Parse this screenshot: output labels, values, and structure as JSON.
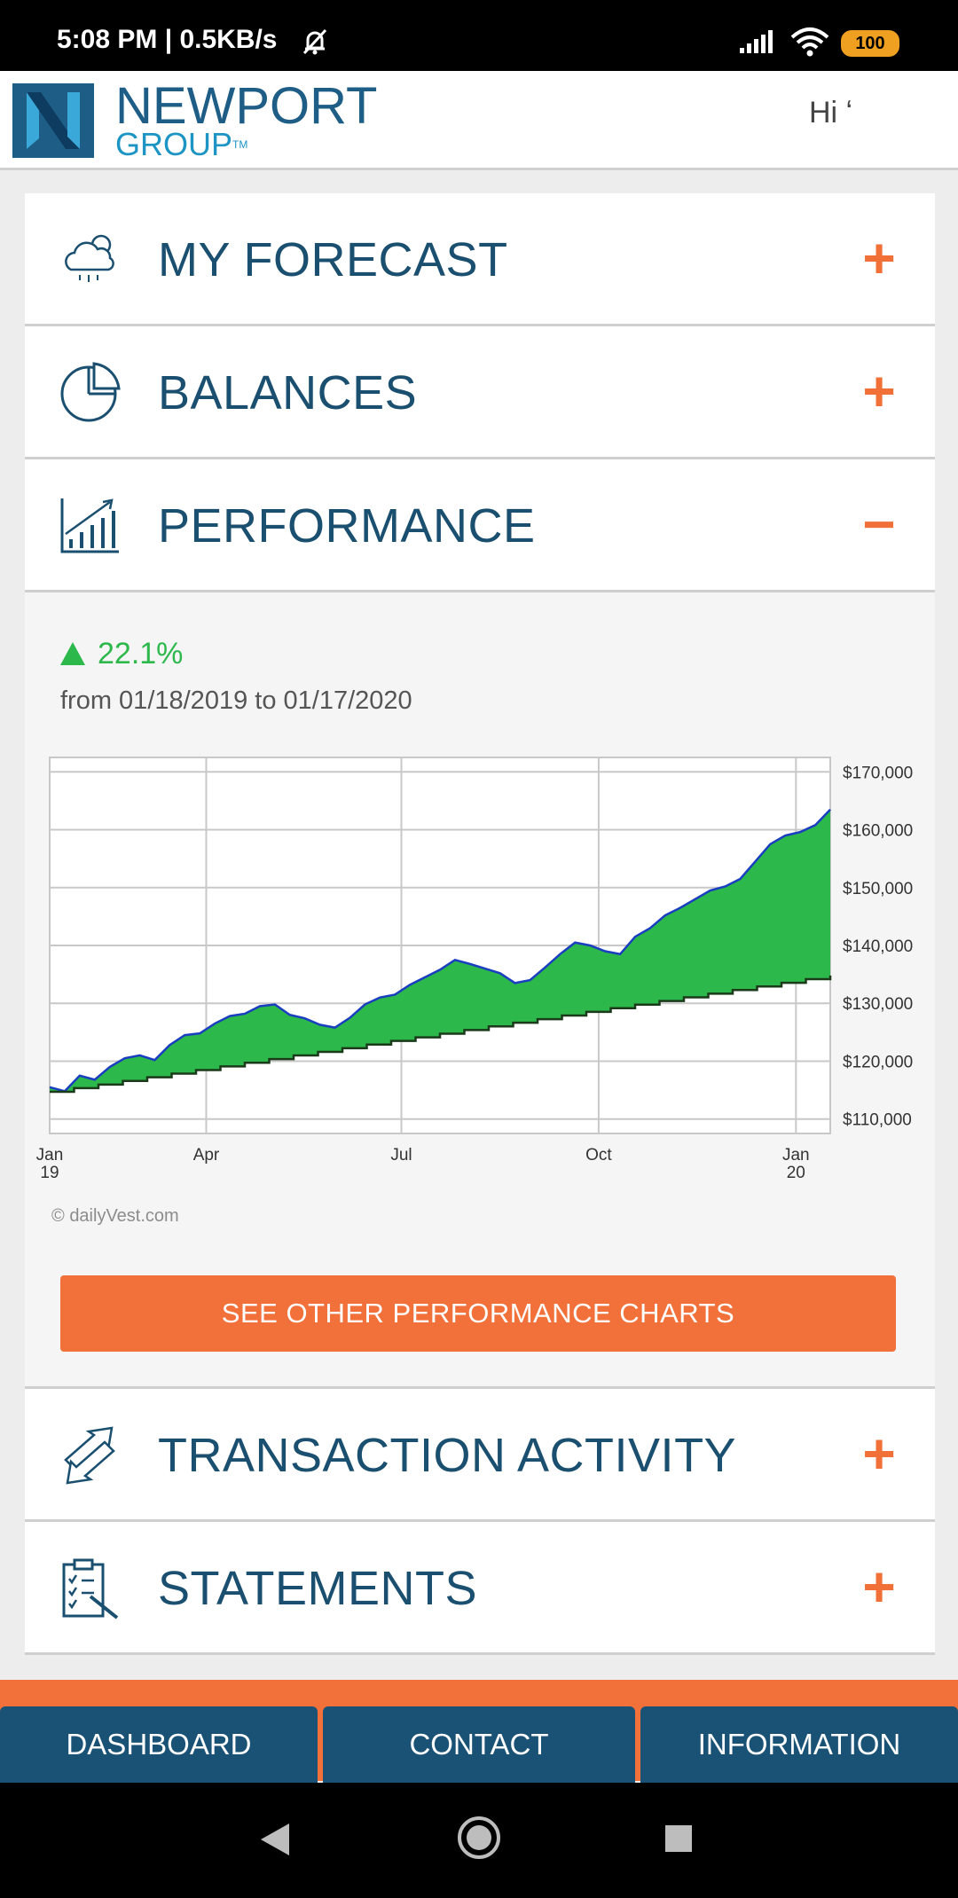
{
  "status_bar": {
    "time": "5:08 PM | 0.5KB/s",
    "battery": "100"
  },
  "header": {
    "logo_line1": "NEWPORT",
    "logo_line2": "GROUP",
    "logo_tm": "TM",
    "greeting": "Hi ʻ"
  },
  "accordion": {
    "forecast_label": "MY FORECAST",
    "balances_label": "BALANCES",
    "performance_label": "PERFORMANCE",
    "transactions_label": "TRANSACTION ACTIVITY",
    "statements_label": "STATEMENTS",
    "expand_symbol": "+",
    "collapse_symbol": "−"
  },
  "performance": {
    "change": "22.1%",
    "range": "from 01/18/2019 to 01/17/2020",
    "button_label": "SEE OTHER PERFORMANCE CHARTS",
    "credit": "dailyVest.com",
    "credit_symbol": "©"
  },
  "chart_data": {
    "type": "area",
    "x_ticks": [
      {
        "label": [
          "Jan",
          "19"
        ],
        "date": "2019-01-18"
      },
      {
        "label": [
          "Apr"
        ],
        "date": "2019-04-01"
      },
      {
        "label": [
          "Jul"
        ],
        "date": "2019-07-01"
      },
      {
        "label": [
          "Oct"
        ],
        "date": "2019-10-01"
      },
      {
        "label": [
          "Jan",
          "20"
        ],
        "date": "2020-01-01"
      }
    ],
    "x_range": [
      "2019-01-18",
      "2020-01-17"
    ],
    "y_ticks": [
      "$170,000",
      "$160,000",
      "$150,000",
      "$140,000",
      "$130,000",
      "$120,000",
      "$110,000"
    ],
    "y_tick_values": [
      170000,
      160000,
      150000,
      140000,
      130000,
      120000,
      110000
    ],
    "ylim": [
      107500,
      172500
    ],
    "grid": true,
    "series": [
      {
        "role": "balance",
        "color": "#2db84b",
        "line_color": "#1a3ec0",
        "points": [
          [
            "2019-01-18",
            115500
          ],
          [
            "2019-01-25",
            114800
          ],
          [
            "2019-02-01",
            117500
          ],
          [
            "2019-02-08",
            116800
          ],
          [
            "2019-02-15",
            119000
          ],
          [
            "2019-02-22",
            120500
          ],
          [
            "2019-03-01",
            121000
          ],
          [
            "2019-03-08",
            120200
          ],
          [
            "2019-03-15",
            122800
          ],
          [
            "2019-03-22",
            124500
          ],
          [
            "2019-03-29",
            124800
          ],
          [
            "2019-04-05",
            126500
          ],
          [
            "2019-04-12",
            127800
          ],
          [
            "2019-04-19",
            128200
          ],
          [
            "2019-04-26",
            129500
          ],
          [
            "2019-05-03",
            129800
          ],
          [
            "2019-05-10",
            128000
          ],
          [
            "2019-05-17",
            127400
          ],
          [
            "2019-05-24",
            126300
          ],
          [
            "2019-05-31",
            125800
          ],
          [
            "2019-06-07",
            127500
          ],
          [
            "2019-06-14",
            129800
          ],
          [
            "2019-06-21",
            131000
          ],
          [
            "2019-06-28",
            131500
          ],
          [
            "2019-07-05",
            133200
          ],
          [
            "2019-07-12",
            134500
          ],
          [
            "2019-07-19",
            135800
          ],
          [
            "2019-07-26",
            137500
          ],
          [
            "2019-08-02",
            136800
          ],
          [
            "2019-08-09",
            136000
          ],
          [
            "2019-08-16",
            135200
          ],
          [
            "2019-08-23",
            133500
          ],
          [
            "2019-08-30",
            134000
          ],
          [
            "2019-09-06",
            136200
          ],
          [
            "2019-09-13",
            138500
          ],
          [
            "2019-09-20",
            140500
          ],
          [
            "2019-09-27",
            140000
          ],
          [
            "2019-10-04",
            139000
          ],
          [
            "2019-10-11",
            138500
          ],
          [
            "2019-10-18",
            141500
          ],
          [
            "2019-10-25",
            143000
          ],
          [
            "2019-11-01",
            145200
          ],
          [
            "2019-11-08",
            146500
          ],
          [
            "2019-11-15",
            148000
          ],
          [
            "2019-11-22",
            149500
          ],
          [
            "2019-11-29",
            150200
          ],
          [
            "2019-12-06",
            151500
          ],
          [
            "2019-12-13",
            154500
          ],
          [
            "2019-12-20",
            157500
          ],
          [
            "2019-12-27",
            159000
          ],
          [
            "2020-01-03",
            159600
          ],
          [
            "2020-01-10",
            160800
          ],
          [
            "2020-01-17",
            163500
          ]
        ]
      },
      {
        "role": "contributions",
        "color": "#1a3a1a",
        "start": [
          "2019-01-18",
          114700
        ],
        "end": [
          "2020-01-17",
          134800
        ]
      }
    ]
  }
}
